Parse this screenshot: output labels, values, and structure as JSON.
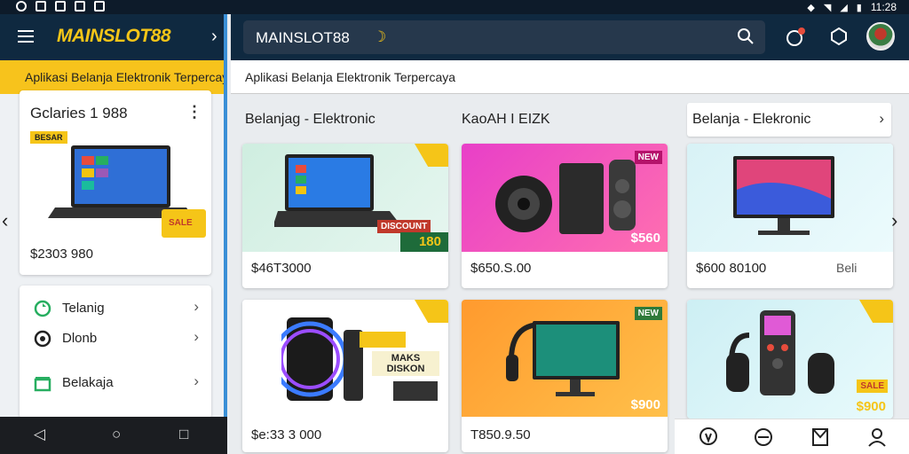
{
  "status": {
    "time": "11:28"
  },
  "app": {
    "logo": "MAINSLOT88"
  },
  "left": {
    "banner": "Aplikasi Belanja Elektronik Terpercaya",
    "card": {
      "title": "Gclaries 1 988",
      "tag": "BESAR",
      "sale": "SALE",
      "price": "$2303 980"
    },
    "menu": [
      {
        "label": "Telanig",
        "icon": "refresh-icon"
      },
      {
        "label": "Dlonb",
        "icon": "info-icon"
      },
      {
        "label": "Belakaja",
        "icon": "store-icon"
      }
    ]
  },
  "search": {
    "value": "MAINSLOT88"
  },
  "banner": {
    "text": "Aplikasi Belanja Elektronik Terpercaya"
  },
  "columns": {
    "c1": "Belanjag - Elektronic",
    "c2": "KaoAH I EIZK",
    "c3": "Belanja - Elekronic"
  },
  "products": [
    {
      "price": "$46T3000",
      "tag": "180",
      "promo": "DISCOUNT"
    },
    {
      "price": "$650.S.00",
      "tag": "$560",
      "promo": "NEW"
    },
    {
      "price": "$600 80100",
      "tag": "Beli",
      "promo": ""
    },
    {
      "price": "$e:33 3 000",
      "tag": "",
      "promo": "MAKS DISKON"
    },
    {
      "price": "T850.9.50",
      "tag": "$900",
      "promo": "NEW"
    },
    {
      "price": "",
      "tag": "$900",
      "promo": "SALE"
    }
  ],
  "colors": {
    "accent": "#f5c518",
    "header": "#0f2940",
    "blue": "#3a8fd6"
  }
}
